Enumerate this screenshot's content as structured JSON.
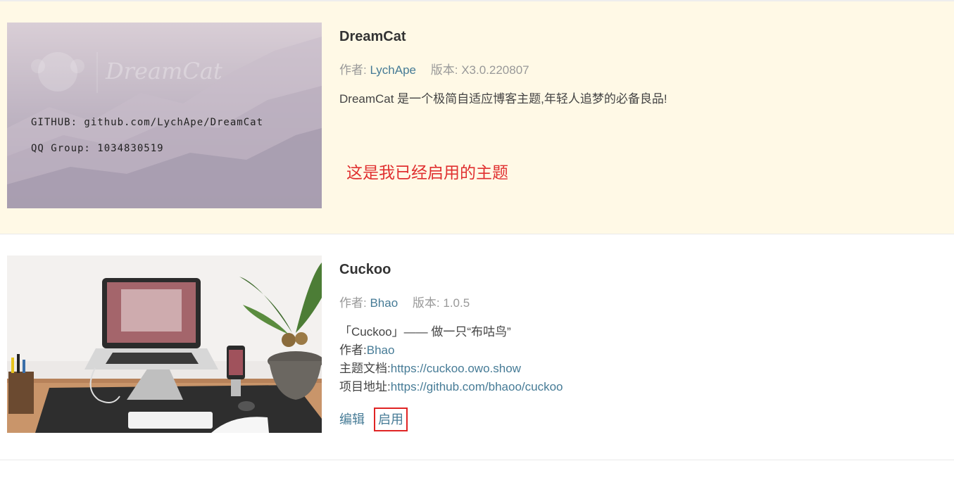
{
  "themes": [
    {
      "name": "DreamCat",
      "author_label": "作者:",
      "author": "LychApe",
      "version_label": "版本:",
      "version": "X3.0.220807",
      "description": "DreamCat 是一个极简自适应博客主题,年轻人追梦的必备良品!",
      "preview": {
        "logo_text": "DreamCat",
        "github": "GITHUB: github.com/LychApe/DreamCat",
        "qq": "QQ Group: 1034830519"
      },
      "annotation": "这是我已经启用的主题"
    },
    {
      "name": "Cuckoo",
      "author_label": "作者:",
      "author": "Bhao",
      "version_label": "版本:",
      "version": "1.0.5",
      "desc_line1": "「Cuckoo」—— 做一只“布咕鸟”",
      "desc_author_label": "作者:",
      "desc_author": "Bhao",
      "desc_docs_label": "主题文档:",
      "desc_docs_url": "https://cuckoo.owo.show",
      "desc_repo_label": "项目地址:",
      "desc_repo_url": "https://github.com/bhaoo/cuckoo",
      "edit_label": "编辑",
      "enable_label": "启用"
    }
  ]
}
